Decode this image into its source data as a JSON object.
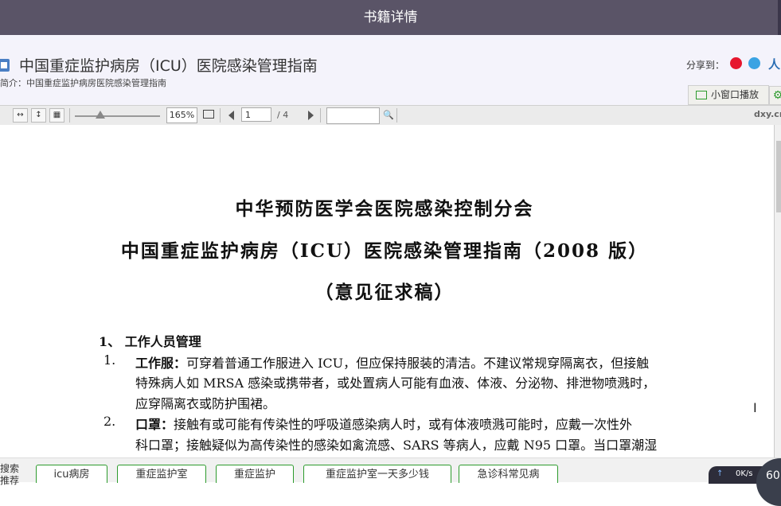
{
  "window": {
    "title": "书籍详情"
  },
  "header": {
    "doc_title": "中国重症监护病房（ICU）医院感染管理指南",
    "summary": "简介：中国重症监护病房医院感染管理指南",
    "share_label": "分享到：",
    "share_icons": [
      "weibo-icon",
      "qzone-icon"
    ],
    "renren_label": "人",
    "mini_window_label": "小窗口播放"
  },
  "toolbar": {
    "zoom": "165%",
    "page_current": "1",
    "page_total": "/ 4",
    "search_value": "",
    "domain": "dxy.cn"
  },
  "document": {
    "heading1": "中华预防医学会医院感染控制分会",
    "heading2": "中国重症监护病房（ICU）医院感染管理指南（2008 版）",
    "heading3": "（意见征求稿）",
    "section": "1、   工作人员管理",
    "items": [
      {
        "num": "1.",
        "lines": [
          {
            "bold": "工作服：",
            "text": "可穿着普通工作服进入 ICU，但应保持服装的清洁。不建议常规穿隔离衣，但接触"
          },
          {
            "bold": "",
            "text": "特殊病人如 MRSA 感染或携带者，或处置病人可能有血液、体液、分泌物、排泄物喷溅时，"
          },
          {
            "bold": "",
            "text": "应穿隔离衣或防护围裙。"
          }
        ]
      },
      {
        "num": "2.",
        "lines": [
          {
            "bold": "口罩：",
            "text": "接触有或可能有传染性的呼吸道感染病人时，或有体液喷溅可能时，应戴一次性外"
          },
          {
            "bold": "",
            "text": "科口罩；接触疑似为高传染性的感染如禽流感、SARS 等病人，应戴 N95 口罩。当口罩潮湿"
          }
        ]
      }
    ]
  },
  "bottom_bar": {
    "side_label": "搜索推荐",
    "tags": [
      "icu病房",
      "重症监护室",
      "重症监护",
      "重症监护室一天多少钱",
      "急诊科常见病"
    ],
    "net_speed": "0K/s",
    "ball_label": "60"
  }
}
